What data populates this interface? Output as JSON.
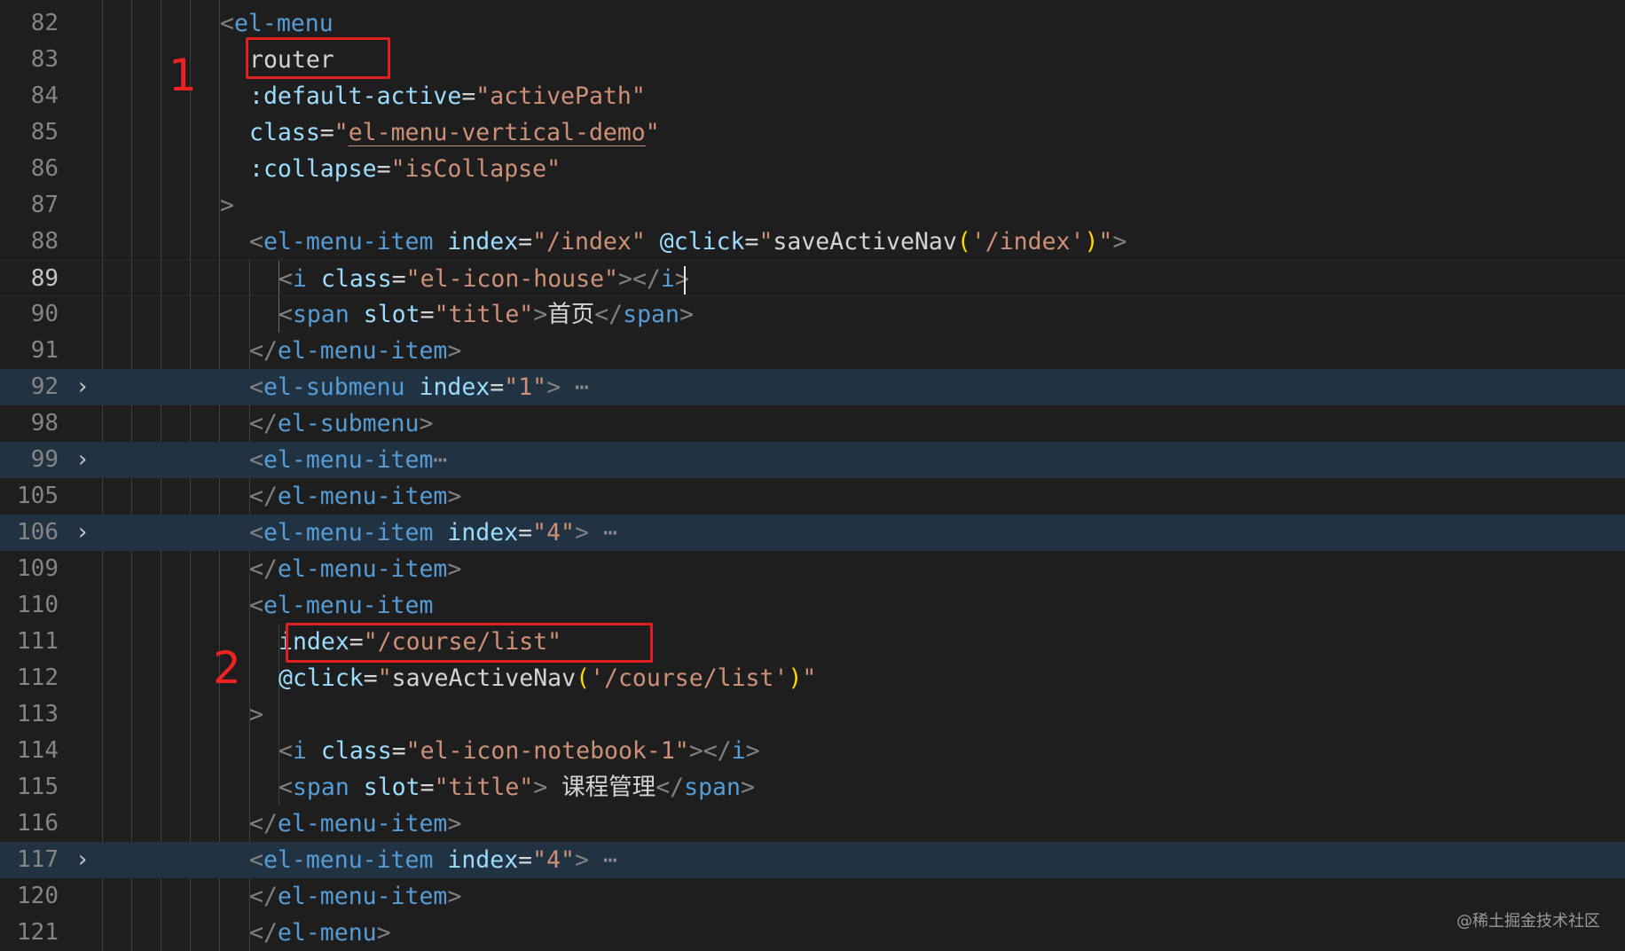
{
  "editor": {
    "lines": [
      {
        "num": "82",
        "tokens": [
          [
            "pu",
            "<"
          ],
          [
            "tg",
            "el-menu"
          ]
        ]
      },
      {
        "num": "83",
        "tokens": [
          [
            "tx",
            "router"
          ]
        ]
      },
      {
        "num": "84",
        "tokens": [
          [
            "at",
            ":default-active"
          ],
          [
            "tx",
            "="
          ],
          [
            "st",
            "\""
          ],
          [
            "st",
            "activePath"
          ],
          [
            "st",
            "\""
          ]
        ]
      },
      {
        "num": "85",
        "tokens": [
          [
            "at",
            "class"
          ],
          [
            "tx",
            "="
          ],
          [
            "st",
            "\""
          ],
          [
            "st squig",
            "el-menu-vertical-demo"
          ],
          [
            "st",
            "\""
          ]
        ]
      },
      {
        "num": "86",
        "tokens": [
          [
            "at",
            ":collapse"
          ],
          [
            "tx",
            "="
          ],
          [
            "st",
            "\""
          ],
          [
            "st",
            "isCollapse"
          ],
          [
            "st",
            "\""
          ]
        ]
      },
      {
        "num": "87",
        "tokens": [
          [
            "pu",
            ">"
          ]
        ]
      },
      {
        "num": "88",
        "tokens": [
          [
            "pu",
            "<"
          ],
          [
            "tg",
            "el-menu-item"
          ],
          [
            "tx",
            " "
          ],
          [
            "at",
            "index"
          ],
          [
            "tx",
            "="
          ],
          [
            "st",
            "\"/index\""
          ],
          [
            "tx",
            " "
          ],
          [
            "at",
            "@click"
          ],
          [
            "tx",
            "="
          ],
          [
            "st",
            "\""
          ],
          [
            "tx",
            "saveActiveNav"
          ],
          [
            "br",
            "("
          ],
          [
            "st",
            "'/index'"
          ],
          [
            "br",
            ")"
          ],
          [
            "st",
            "\""
          ],
          [
            "pu",
            ">"
          ]
        ]
      },
      {
        "num": "89",
        "active": true,
        "tokens": [
          [
            "pu",
            "<"
          ],
          [
            "tg",
            "i"
          ],
          [
            "tx",
            " "
          ],
          [
            "at",
            "class"
          ],
          [
            "tx",
            "="
          ],
          [
            "st",
            "\"el-icon-house\""
          ],
          [
            "pu",
            "></"
          ],
          [
            "tg",
            "i"
          ],
          [
            "pu",
            ">"
          ]
        ]
      },
      {
        "num": "90",
        "tokens": [
          [
            "pu",
            "<"
          ],
          [
            "tg",
            "span"
          ],
          [
            "tx",
            " "
          ],
          [
            "at",
            "slot"
          ],
          [
            "tx",
            "="
          ],
          [
            "st",
            "\"title\""
          ],
          [
            "pu",
            ">"
          ],
          [
            "tx",
            "首页"
          ],
          [
            "pu",
            "</"
          ],
          [
            "tg",
            "span"
          ],
          [
            "pu",
            ">"
          ]
        ]
      },
      {
        "num": "91",
        "tokens": [
          [
            "pu",
            "</"
          ],
          [
            "tg",
            "el-menu-item"
          ],
          [
            "pu",
            ">"
          ]
        ]
      },
      {
        "num": "92",
        "fold": true,
        "tokens": [
          [
            "pu",
            "<"
          ],
          [
            "tg",
            "el-submenu"
          ],
          [
            "tx",
            " "
          ],
          [
            "at",
            "index"
          ],
          [
            "tx",
            "="
          ],
          [
            "st",
            "\"1\""
          ],
          [
            "pu",
            ">"
          ],
          [
            "dots",
            " ⋯"
          ]
        ]
      },
      {
        "num": "98",
        "tokens": [
          [
            "pu",
            "</"
          ],
          [
            "tg",
            "el-submenu"
          ],
          [
            "pu",
            ">"
          ]
        ]
      },
      {
        "num": "99",
        "fold": true,
        "tokens": [
          [
            "pu",
            "<"
          ],
          [
            "tg",
            "el-menu-item"
          ],
          [
            "dots",
            "⋯"
          ]
        ]
      },
      {
        "num": "105",
        "tokens": [
          [
            "pu",
            "</"
          ],
          [
            "tg",
            "el-menu-item"
          ],
          [
            "pu",
            ">"
          ]
        ]
      },
      {
        "num": "106",
        "fold": true,
        "tokens": [
          [
            "pu",
            "<"
          ],
          [
            "tg",
            "el-menu-item"
          ],
          [
            "tx",
            " "
          ],
          [
            "at",
            "index"
          ],
          [
            "tx",
            "="
          ],
          [
            "st",
            "\"4\""
          ],
          [
            "pu",
            ">"
          ],
          [
            "dots",
            " ⋯"
          ]
        ]
      },
      {
        "num": "109",
        "tokens": [
          [
            "pu",
            "</"
          ],
          [
            "tg",
            "el-menu-item"
          ],
          [
            "pu",
            ">"
          ]
        ]
      },
      {
        "num": "110",
        "tokens": [
          [
            "pu",
            "<"
          ],
          [
            "tg",
            "el-menu-item"
          ]
        ]
      },
      {
        "num": "111",
        "tokens": [
          [
            "at",
            "index"
          ],
          [
            "tx",
            "="
          ],
          [
            "st",
            "\"/course/list\""
          ]
        ]
      },
      {
        "num": "112",
        "tokens": [
          [
            "at",
            "@click"
          ],
          [
            "tx",
            "="
          ],
          [
            "st",
            "\""
          ],
          [
            "tx",
            "saveActiveNav"
          ],
          [
            "br",
            "("
          ],
          [
            "st",
            "'/course/list'"
          ],
          [
            "br",
            ")"
          ],
          [
            "st",
            "\""
          ]
        ]
      },
      {
        "num": "113",
        "tokens": [
          [
            "pu",
            ">"
          ]
        ]
      },
      {
        "num": "114",
        "tokens": [
          [
            "pu",
            "<"
          ],
          [
            "tg",
            "i"
          ],
          [
            "tx",
            " "
          ],
          [
            "at",
            "class"
          ],
          [
            "tx",
            "="
          ],
          [
            "st",
            "\"el-icon-notebook-1\""
          ],
          [
            "pu",
            "></"
          ],
          [
            "tg",
            "i"
          ],
          [
            "pu",
            ">"
          ]
        ]
      },
      {
        "num": "115",
        "tokens": [
          [
            "pu",
            "<"
          ],
          [
            "tg",
            "span"
          ],
          [
            "tx",
            " "
          ],
          [
            "at",
            "slot"
          ],
          [
            "tx",
            "="
          ],
          [
            "st",
            "\"title\""
          ],
          [
            "pu",
            ">"
          ],
          [
            "tx",
            " 课程管理"
          ],
          [
            "pu",
            "</"
          ],
          [
            "tg",
            "span"
          ],
          [
            "pu",
            ">"
          ]
        ]
      },
      {
        "num": "116",
        "tokens": [
          [
            "pu",
            "</"
          ],
          [
            "tg",
            "el-menu-item"
          ],
          [
            "pu",
            ">"
          ]
        ]
      },
      {
        "num": "117",
        "fold": true,
        "tokens": [
          [
            "pu",
            "<"
          ],
          [
            "tg",
            "el-menu-item"
          ],
          [
            "tx",
            " "
          ],
          [
            "at",
            "index"
          ],
          [
            "tx",
            "="
          ],
          [
            "st",
            "\"4\""
          ],
          [
            "pu",
            ">"
          ],
          [
            "dots",
            " ⋯"
          ]
        ]
      },
      {
        "num": "120",
        "tokens": [
          [
            "pu",
            "</"
          ],
          [
            "tg",
            "el-menu-item"
          ],
          [
            "pu",
            ">"
          ]
        ]
      },
      {
        "num": "121",
        "tokens": [
          [
            "pu",
            "</"
          ],
          [
            "tg",
            "el-menu"
          ],
          [
            "pu",
            ">"
          ]
        ]
      }
    ]
  },
  "annotations": {
    "label1": "1",
    "label2": "2"
  },
  "watermark": "@稀土掘金技术社区",
  "colors": {
    "background": "#1e1e1e",
    "folded_line": "#213342",
    "line_number": "#858585",
    "tag": "#569cd6",
    "attribute": "#9cdcfe",
    "string": "#ce9178",
    "punctuation": "#808080",
    "bracket": "#ffd700",
    "annotation": "#e02020"
  },
  "icons": {
    "fold": "chevron-right-icon"
  }
}
